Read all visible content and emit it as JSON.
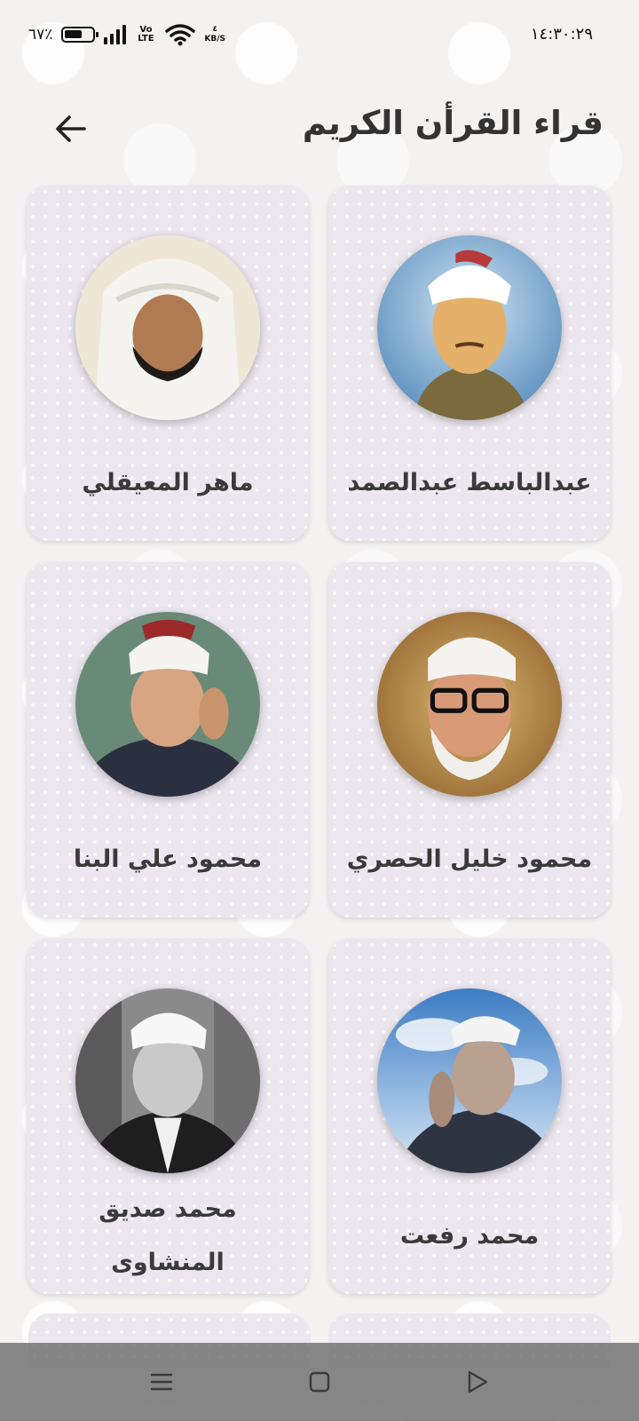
{
  "status_bar": {
    "battery_percent": "٦٧٪",
    "battery_level": 0.67,
    "network_type": "Vo LTE",
    "speed_value": "٤",
    "speed_unit": "KB/S",
    "time": "١٤:٣٠:٢٩"
  },
  "header": {
    "title": "قراء القرأن الكريم",
    "back_icon": "arrow-left-icon"
  },
  "reciters": [
    {
      "name": "عبدالباسط عبدالصمد",
      "portrait": "reciter-portrait"
    },
    {
      "name": "ماهر المعيقلي",
      "portrait": "reciter-portrait"
    },
    {
      "name": "محمود خليل الحصري",
      "portrait": "reciter-portrait"
    },
    {
      "name": "محمود علي البنا",
      "portrait": "reciter-portrait"
    },
    {
      "name": "محمد رفعت",
      "portrait": "reciter-portrait"
    },
    {
      "name": "محمد صديق المنشاوى",
      "portrait": "reciter-portrait"
    }
  ],
  "navigation": {
    "menu_icon": "menu-icon",
    "home_icon": "square-icon",
    "back_icon": "triangle-back-icon"
  },
  "colors": {
    "card_background": "#ece6ef",
    "title_text": "#333333",
    "nav_bar": "#6e6e6e"
  }
}
